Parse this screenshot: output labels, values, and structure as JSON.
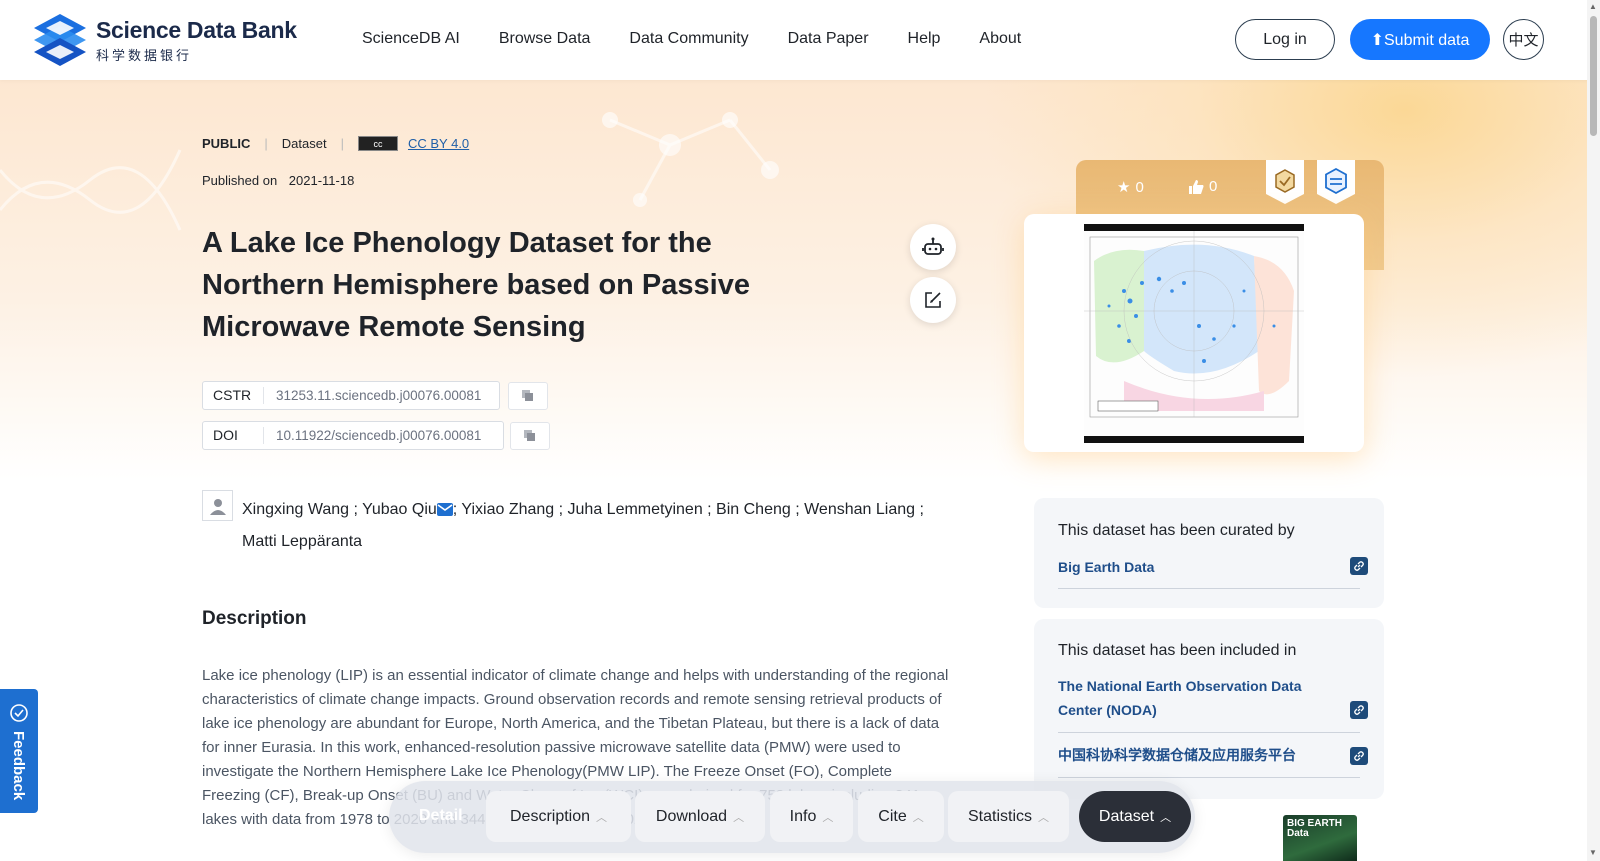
{
  "header": {
    "logo_en": "Science Data Bank",
    "logo_cn": "科学数据银行",
    "nav": [
      "ScienceDB AI",
      "Browse Data",
      "Data Community",
      "Data Paper",
      "Help",
      "About"
    ],
    "login": "Log in",
    "submit": "Submit data",
    "lang": "中文"
  },
  "dataset": {
    "visibility": "PUBLIC",
    "type": "Dataset",
    "license_badge": "cc",
    "license": "CC BY 4.0",
    "published_label": "Published on",
    "published_date": "2021-11-18",
    "title": "A Lake Ice Phenology Dataset for the Northern Hemisphere based on Passive Microwave Remote Sensing",
    "cstr_label": "CSTR",
    "cstr": "31253.11.sciencedb.j00076.00081",
    "doi_label": "DOI",
    "doi": "10.11922/sciencedb.j00076.00081",
    "authors_line1": "Xingxing Wang ; Yubao Qiu",
    "authors_line1b": "; Yixiao Zhang ; Juha Lemmetyinen ; Bin Cheng ; Wenshan Liang ;",
    "authors_line2": "Matti Leppäranta",
    "description_heading": "Description",
    "description": "Lake ice phenology (LIP) is an essential indicator of climate change and helps with understanding of the regional characteristics of climate change impacts. Ground observation records and remote sensing retrieval products of lake ice phenology are abundant for Europe, North America, and the Tibetan Plateau, but there is a lack of data for inner Eurasia. In this work, enhanced-resolution passive microwave satellite data (PMW) were used to investigate the Northern Hemisphere Lake Ice Phenology(PMW LIP). The Freeze Onset (FO), Complete Freezing (CF), Break-up Onset (BU) and Water Clean of Ice (WCI) were derived for 753 lakes, including 341 lakes with data from 1978 to 2020 and 344 lakes from 2002 to 2020."
  },
  "sidebar": {
    "stars": "0",
    "likes": "0",
    "curated_heading": "This dataset has been curated by",
    "curated_by": "Big Earth Data",
    "included_heading": "This dataset has been included in",
    "included": [
      "The National Earth Observation Data Center (NODA)",
      "中国科协科学数据仓储及应用服务平台"
    ],
    "journal_cover": "BIG EARTH Data"
  },
  "feedback": "Feedback",
  "float_nav": {
    "detail": "Detail",
    "items": [
      "Description",
      "Download",
      "Info",
      "Cite",
      "Statistics",
      "Dataset"
    ],
    "active": "Dataset"
  },
  "colors": {
    "accent": "#1677ff",
    "link": "#1f4e8a",
    "hero": "#fde7d1",
    "active_tab": "#2b2f38"
  }
}
